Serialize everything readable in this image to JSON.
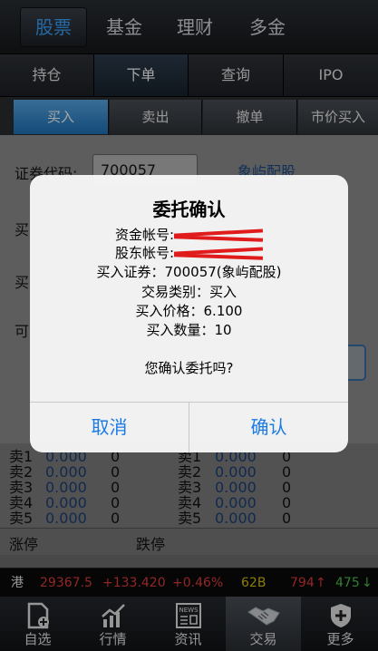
{
  "top_tabs": [
    "股票",
    "基金",
    "理财",
    "多金"
  ],
  "sub_tabs": [
    "持仓",
    "下单",
    "查询",
    "IPO"
  ],
  "third_tabs": [
    "买入",
    "卖出",
    "撤单",
    "市价买入"
  ],
  "form": {
    "code_label": "证券代码:",
    "code_value": "700057",
    "stock_name": "象屿配股",
    "row2_label": "买",
    "row3_label": "买",
    "row4_label": "可"
  },
  "quotes": {
    "sell_left": [
      {
        "label": "卖1",
        "price": "0.000",
        "vol": "0"
      },
      {
        "label": "卖2",
        "price": "0.000",
        "vol": "0"
      },
      {
        "label": "卖3",
        "price": "0.000",
        "vol": "0"
      },
      {
        "label": "卖4",
        "price": "0.000",
        "vol": "0"
      },
      {
        "label": "卖5",
        "price": "0.000",
        "vol": "0"
      }
    ],
    "sell_right": [
      {
        "label": "卖1",
        "price": "0.000",
        "vol": "0"
      },
      {
        "label": "卖2",
        "price": "0.000",
        "vol": "0"
      },
      {
        "label": "卖3",
        "price": "0.000",
        "vol": "0"
      },
      {
        "label": "卖4",
        "price": "0.000",
        "vol": "0"
      },
      {
        "label": "卖5",
        "price": "0.000",
        "vol": "0"
      }
    ],
    "limit_up": "涨停",
    "limit_down": "跌停"
  },
  "ticker": {
    "market": "港",
    "index": "29367.5",
    "change": "+133.420",
    "pct": "+0.46%",
    "turnover": "62B",
    "up_count": "794",
    "up_arrow": "↑",
    "down_count": "475",
    "down_arrow": "↓"
  },
  "bottom_nav": [
    "自选",
    "行情",
    "资讯",
    "交易",
    "更多"
  ],
  "news_icon_text": "NEWS",
  "dialog": {
    "title": "委托确认",
    "fund_account_label": "资金帐号:",
    "holder_account_label": "股东帐号:",
    "buy_security": "买入证券：700057(象屿配股)",
    "trade_type": "交易类别：买入",
    "buy_price": "买入价格：6.100",
    "buy_qty": "买入数量：10",
    "question": "您确认委托吗?",
    "cancel": "取消",
    "confirm": "确认"
  },
  "colors": {
    "accent_blue": "#1a7ae6",
    "active_tab": "#3aa3ff",
    "ticker_red": "#e23b3b",
    "ticker_yellow": "#d8c200",
    "ticker_green": "#4fc24f"
  }
}
